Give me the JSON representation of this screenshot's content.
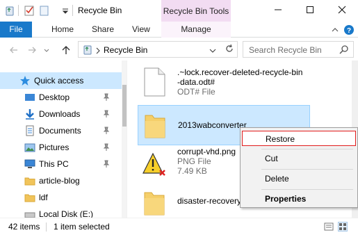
{
  "window": {
    "title": "Recycle Bin",
    "context_tab_title": "Recycle Bin Tools",
    "minimize_icon": "minimize-icon",
    "maximize_icon": "maximize-icon",
    "close_icon": "close-icon"
  },
  "ribbon": {
    "file_tab": "File",
    "tabs": [
      "Home",
      "Share",
      "View"
    ],
    "manage_tab": "Manage",
    "accent": "#1979ca",
    "context_tab_color": "#f2dcf2"
  },
  "address": {
    "path": "Recycle Bin",
    "search_placeholder": "Search Recycle Bin"
  },
  "nav": {
    "items": [
      {
        "label": "Quick access",
        "icon": "star-icon"
      },
      {
        "label": "Desktop",
        "icon": "desktop-icon"
      },
      {
        "label": "Downloads",
        "icon": "download-icon"
      },
      {
        "label": "Documents",
        "icon": "documents-icon"
      },
      {
        "label": "Pictures",
        "icon": "pictures-icon"
      },
      {
        "label": "This PC",
        "icon": "computer-icon"
      },
      {
        "label": "article-blog",
        "icon": "folder-icon"
      },
      {
        "label": "ldf",
        "icon": "folder-icon"
      },
      {
        "label": "Local Disk (E:)",
        "icon": "drive-icon"
      }
    ]
  },
  "files": [
    {
      "name_line1": ".~lock.recover-deleted-recycle-bin",
      "name_line2": "-data.odt#",
      "type": "ODT# File",
      "size": "",
      "icon": "document-icon"
    },
    {
      "name_line1": "2013wabconverter",
      "name_line2": "",
      "type": "",
      "size": "",
      "icon": "folder-icon"
    },
    {
      "name_line1": "corrupt-vhd.png",
      "name_line2": "",
      "type": "PNG File",
      "size": "7.49 KB",
      "icon": "warning-file-icon"
    },
    {
      "name_line1": "disaster-recovery-",
      "name_line2": "",
      "type": "",
      "size": "",
      "icon": "folder-icon"
    }
  ],
  "context_menu": {
    "items": [
      "Restore",
      "Cut",
      "Delete",
      "Properties"
    ]
  },
  "status": {
    "count": "42 items",
    "selection": "1 item selected"
  }
}
